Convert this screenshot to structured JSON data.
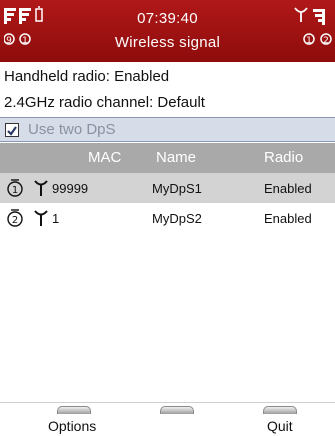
{
  "header": {
    "time": "07:39:40",
    "title": "Wireless signal",
    "left_icons": [
      "signal-bars-icon",
      "signal-bars-icon",
      "battery-icon",
      "dps-1-icon",
      "dps-2-icon"
    ],
    "right_icons": [
      "antenna-icon",
      "signal-bars-icon",
      "dps-2-icon",
      "dps-1-icon"
    ],
    "color": "#a01212"
  },
  "info": {
    "handheld_radio": "Handheld radio: Enabled",
    "channel": "2.4GHz radio channel: Default"
  },
  "option": {
    "checked": true,
    "label": "Use two DpS"
  },
  "table": {
    "columns": [
      "MAC",
      "Name",
      "Radio"
    ],
    "rows": [
      {
        "index_icon": "dps-1-icon",
        "mac": "99999",
        "name": "MyDpS1",
        "radio": "Enabled",
        "selected": true
      },
      {
        "index_icon": "dps-2-icon",
        "mac": "1",
        "name": "MyDpS2",
        "radio": "Enabled",
        "selected": false
      }
    ]
  },
  "softkeys": {
    "left": "Options",
    "middle": "",
    "right": "Quit"
  }
}
